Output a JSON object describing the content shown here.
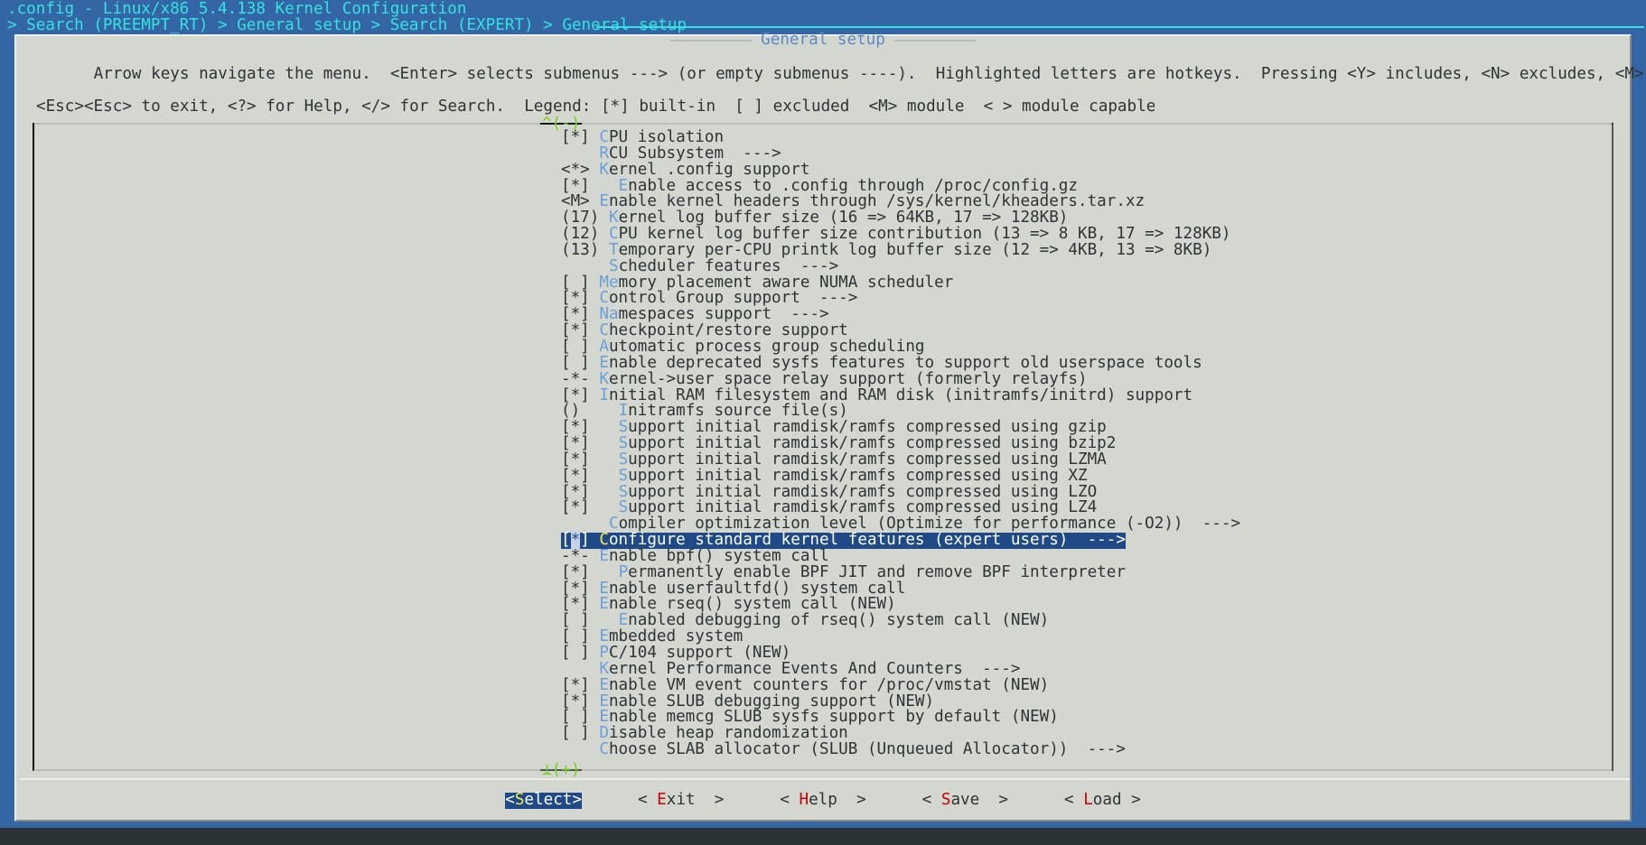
{
  "titlebar": {
    "title": ".config - Linux/x86 5.4.138 Kernel Configuration",
    "breadcrumb": "> Search (PREEMPT_RT) > General setup > Search (EXPERT) > General setup "
  },
  "dialog": {
    "title": "General setup",
    "help_line1": "Arrow keys navigate the menu.  <Enter> selects submenus ---> (or empty submenus ----).  Highlighted letters are hotkeys.  Pressing <Y> includes, <N> excludes, <M> modularizes features.  Press",
    "help_line2": "<Esc><Esc> to exit, <?> for Help, </> for Search.  Legend: [*] built-in  [ ] excluded  <M> module  < > module capable"
  },
  "scroll": {
    "up_hint": "^(-)",
    "down_hint": "⊥(+)"
  },
  "menu": {
    "items": [
      {
        "prefix": "[*] ",
        "hotkey": "C",
        "rest": "PU isolation",
        "selected": false
      },
      {
        "prefix": "    ",
        "hotkey": "R",
        "rest": "CU Subsystem  --->",
        "selected": false
      },
      {
        "prefix": "<*> ",
        "hotkey": "K",
        "rest": "ernel .config support",
        "selected": false
      },
      {
        "prefix": "[*]   ",
        "hotkey": "E",
        "rest": "nable access to .config through /proc/config.gz",
        "selected": false
      },
      {
        "prefix": "<M> ",
        "hotkey": "E",
        "rest": "nable kernel headers through /sys/kernel/kheaders.tar.xz",
        "selected": false
      },
      {
        "prefix": "(17) ",
        "hotkey": "K",
        "rest": "ernel log buffer size (16 => 64KB, 17 => 128KB)",
        "selected": false
      },
      {
        "prefix": "(12) ",
        "hotkey": "C",
        "rest": "PU kernel log buffer size contribution (13 => 8 KB, 17 => 128KB)",
        "selected": false
      },
      {
        "prefix": "(13) ",
        "hotkey": "T",
        "rest": "emporary per-CPU printk log buffer size (12 => 4KB, 13 => 8KB)",
        "selected": false
      },
      {
        "prefix": "     ",
        "hotkey": "S",
        "rest": "cheduler features  --->",
        "selected": false
      },
      {
        "prefix": "[ ] ",
        "hotkey": "Me",
        "rest": "mory placement aware NUMA scheduler",
        "selected": false
      },
      {
        "prefix": "[*] ",
        "hotkey": "C",
        "rest": "ontrol Group support  --->",
        "selected": false
      },
      {
        "prefix": "[*] ",
        "hotkey": "Na",
        "rest": "mespaces support  --->",
        "selected": false
      },
      {
        "prefix": "[*] ",
        "hotkey": "C",
        "rest": "heckpoint/restore support",
        "selected": false
      },
      {
        "prefix": "[ ] ",
        "hotkey": "A",
        "rest": "utomatic process group scheduling",
        "selected": false
      },
      {
        "prefix": "[ ] ",
        "hotkey": "E",
        "rest": "nable deprecated sysfs features to support old userspace tools",
        "selected": false
      },
      {
        "prefix": "-*- ",
        "hotkey": "K",
        "rest": "ernel->user space relay support (formerly relayfs)",
        "selected": false
      },
      {
        "prefix": "[*] ",
        "hotkey": "I",
        "rest": "nitial RAM filesystem and RAM disk (initramfs/initrd) support",
        "selected": false
      },
      {
        "prefix": "()    ",
        "hotkey": "I",
        "rest": "nitramfs source file(s)",
        "selected": false
      },
      {
        "prefix": "[*]   ",
        "hotkey": "S",
        "rest": "upport initial ramdisk/ramfs compressed using gzip",
        "selected": false
      },
      {
        "prefix": "[*]   ",
        "hotkey": "S",
        "rest": "upport initial ramdisk/ramfs compressed using bzip2",
        "selected": false
      },
      {
        "prefix": "[*]   ",
        "hotkey": "S",
        "rest": "upport initial ramdisk/ramfs compressed using LZMA",
        "selected": false
      },
      {
        "prefix": "[*]   ",
        "hotkey": "S",
        "rest": "upport initial ramdisk/ramfs compressed using XZ",
        "selected": false
      },
      {
        "prefix": "[*]   ",
        "hotkey": "S",
        "rest": "upport initial ramdisk/ramfs compressed using LZO",
        "selected": false
      },
      {
        "prefix": "[*]   ",
        "hotkey": "S",
        "rest": "upport initial ramdisk/ramfs compressed using LZ4",
        "selected": false
      },
      {
        "prefix": "     ",
        "hotkey": "C",
        "rest": "ompiler optimization level (Optimize for performance (-O2))  --->",
        "selected": false
      },
      {
        "prefix": "[*] ",
        "hotkey": "C",
        "rest": "onfigure standard kernel features (expert users)  --->",
        "selected": true,
        "cursor_char": "*"
      },
      {
        "prefix": "-*- ",
        "hotkey": "E",
        "rest": "nable bpf() system call",
        "selected": false
      },
      {
        "prefix": "[*]   ",
        "hotkey": "P",
        "rest": "ermanently enable BPF JIT and remove BPF interpreter",
        "selected": false
      },
      {
        "prefix": "[*] ",
        "hotkey": "E",
        "rest": "nable userfaultfd() system call",
        "selected": false
      },
      {
        "prefix": "[*] ",
        "hotkey": "E",
        "rest": "nable rseq() system call (NEW)",
        "selected": false
      },
      {
        "prefix": "[ ]   ",
        "hotkey": "E",
        "rest": "nabled debugging of rseq() system call (NEW)",
        "selected": false
      },
      {
        "prefix": "[ ] ",
        "hotkey": "E",
        "rest": "mbedded system",
        "selected": false
      },
      {
        "prefix": "[ ] ",
        "hotkey": "P",
        "rest": "C/104 support (NEW)",
        "selected": false
      },
      {
        "prefix": "    ",
        "hotkey": "K",
        "rest": "ernel Performance Events And Counters  --->",
        "selected": false
      },
      {
        "prefix": "[*] ",
        "hotkey": "E",
        "rest": "nable VM event counters for /proc/vmstat (NEW)",
        "selected": false
      },
      {
        "prefix": "[*] ",
        "hotkey": "E",
        "rest": "nable SLUB debugging support (NEW)",
        "selected": false
      },
      {
        "prefix": "[ ] ",
        "hotkey": "E",
        "rest": "nable memcg SLUB sysfs support by default (NEW)",
        "selected": false
      },
      {
        "prefix": "[ ] ",
        "hotkey": "D",
        "rest": "isable heap randomization",
        "selected": false
      },
      {
        "prefix": "    ",
        "hotkey": "C",
        "rest": "hoose SLAB allocator (SLUB (Unqueued Allocator))  --->",
        "selected": false
      }
    ]
  },
  "buttons": [
    {
      "pre": "<",
      "hotkey": "S",
      "post": "elect>",
      "active": true
    },
    {
      "pre": "< ",
      "hotkey": "E",
      "post": "xit  >",
      "active": false
    },
    {
      "pre": "< ",
      "hotkey": "H",
      "post": "elp  >",
      "active": false
    },
    {
      "pre": "< ",
      "hotkey": "S",
      "post": "ave  >",
      "active": false
    },
    {
      "pre": "< ",
      "hotkey": "L",
      "post": "oad >",
      "active": false
    }
  ],
  "colors": {
    "frame_blue": "#3465a4",
    "panel_grey": "#d3d7cf",
    "accent_cyan": "#34e2e2",
    "hotkey_blue": "#6a9fd8",
    "hotkey_red": "#cc0000",
    "hotkey_yellow": "#fce94f",
    "selection_blue": "#204a87",
    "scroll_green": "#73d216",
    "title_blue": "#5b8ac9",
    "terminal_bg": "#2b3236"
  }
}
